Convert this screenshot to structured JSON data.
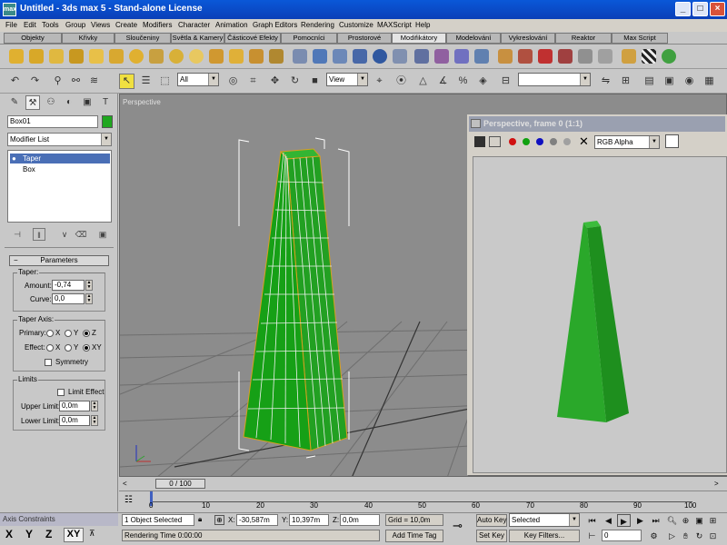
{
  "app": {
    "title": "Untitled - 3ds max 5 - Stand-alone License",
    "icon": "3ds-max-app-icon",
    "window_controls": {
      "minimize": "_",
      "maximize": "□",
      "close": "×"
    }
  },
  "menubar": [
    "File",
    "Edit",
    "Tools",
    "Group",
    "Views",
    "Create",
    "Modifiers",
    "Character",
    "Animation",
    "Graph Editors",
    "Rendering",
    "Customize",
    "MAXScript",
    "Help"
  ],
  "tabs": [
    "Objekty",
    "Křivky",
    "Sloučeniny",
    "Světla & Kamery",
    "Částicové Efekty",
    "Pomocníci",
    "Prostorové",
    "Modifikátory",
    "Modelování",
    "Vykreslování",
    "Reaktor",
    "Max Script"
  ],
  "active_tab": "Modifikátory",
  "main_toolbar": {
    "selection_filter": "All",
    "reference_coord": "View",
    "named_selection": ""
  },
  "command_panel": {
    "object_name": "Box01",
    "object_color": "#1fa71f",
    "modifier_list": "Modifier List",
    "stack": [
      {
        "label": "Taper",
        "selected": true
      },
      {
        "label": "Box",
        "selected": false
      }
    ],
    "parameters": {
      "header": "Parameters",
      "taper_group": "Taper:",
      "amount_label": "Amount:",
      "amount_value": "-0,74",
      "curve_label": "Curve:",
      "curve_value": "0,0",
      "axis_group": "Taper Axis:",
      "primary_label": "Primary:",
      "effect_label": "Effect:",
      "primary_options": [
        "X",
        "Y",
        "Z"
      ],
      "effect_options": [
        "X",
        "Y",
        "XY"
      ],
      "primary_selected": "Z",
      "effect_selected": "XY",
      "symmetry_label": "Symmetry",
      "symmetry": false,
      "limits_group": "Limits",
      "limit_effect_label": "Limit Effect",
      "limit_effect": false,
      "upper_label": "Upper Limit:",
      "upper_value": "0,0m",
      "lower_label": "Lower Limit:",
      "lower_value": "0,0m"
    }
  },
  "viewport": {
    "label": "Perspective"
  },
  "render_window": {
    "title": "Perspective, frame 0 (1:1)",
    "channel": "RGB Alpha"
  },
  "timeline": {
    "slider_text": "0 / 100",
    "ticks": [
      "0",
      "10",
      "20",
      "30",
      "40",
      "50",
      "60",
      "70",
      "80",
      "90",
      "100"
    ]
  },
  "status": {
    "axis_constraints": "Axis Constraints",
    "axes": [
      "X",
      "Y",
      "Z",
      "XY"
    ],
    "active_axis": "XY",
    "selection_info": "1 Object Selected",
    "prompt": "Rendering Time  0:00:00",
    "x_label": "X:",
    "x_value": "-30,587m",
    "y_label": "Y:",
    "y_value": "10,397m",
    "z_label": "Z:",
    "z_value": "0,0m",
    "grid": "Grid = 10,0m",
    "add_time_tag": "Add Time Tag",
    "auto_key": "Auto Key",
    "set_key": "Set Key",
    "key_mode": "Selected",
    "key_filters": "Key Filters...",
    "frame": "0"
  }
}
